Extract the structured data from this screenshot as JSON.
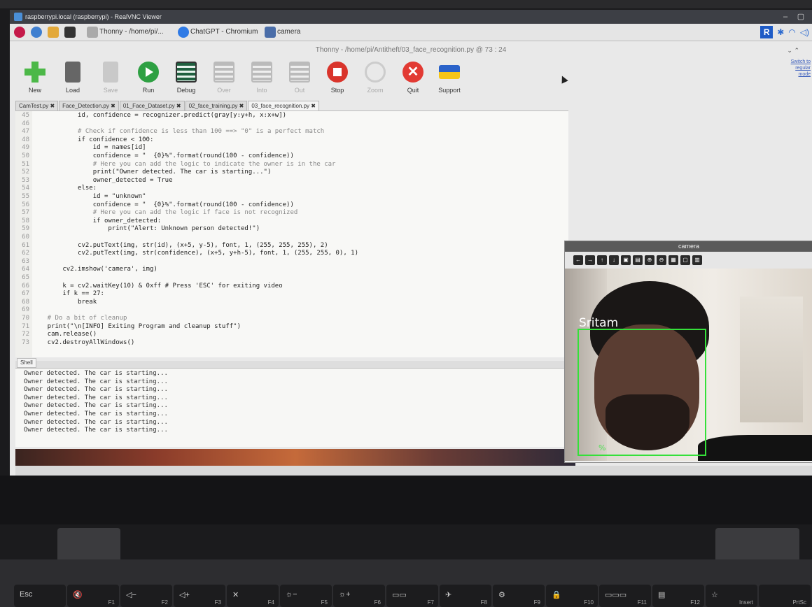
{
  "vnc": {
    "title": "raspberrypi.local (raspberrypi) - RealVNC Viewer"
  },
  "taskbar": {
    "items": [
      {
        "label": "Thonny  -  /home/pi/..."
      },
      {
        "label": "ChatGPT - Chromium"
      },
      {
        "label": "camera"
      }
    ]
  },
  "thonny": {
    "title": "Thonny  -  /home/pi/Antitheft/03_face_recognition.py  @  73 : 24",
    "switch_link": "Switch to regular mode",
    "toolbar": {
      "new": "New",
      "load": "Load",
      "save": "Save",
      "run": "Run",
      "debug": "Debug",
      "over": "Over",
      "into": "Into",
      "out": "Out",
      "stop": "Stop",
      "zoom": "Zoom",
      "quit": "Quit",
      "support": "Support"
    },
    "tabs": [
      {
        "label": "CamTest.py ✖"
      },
      {
        "label": "Face_Detection.py ✖"
      },
      {
        "label": "01_Face_Dataset.py ✖"
      },
      {
        "label": "02_face_training.py ✖"
      },
      {
        "label": "03_face_recognition.py ✖"
      }
    ],
    "code": [
      {
        "ln": "45",
        "text": "            id, confidence = recognizer.predict(gray[y:y+h, x:x+w])"
      },
      {
        "ln": "46",
        "text": ""
      },
      {
        "ln": "47",
        "text": "            # Check if confidence is less than 100 ==> \"0\" is a perfect match"
      },
      {
        "ln": "48",
        "text": "            if confidence < 100:"
      },
      {
        "ln": "49",
        "text": "                id = names[id]"
      },
      {
        "ln": "50",
        "text": "                confidence = \"  {0}%\".format(round(100 - confidence))"
      },
      {
        "ln": "51",
        "text": "                # Here you can add the logic to indicate the owner is in the car"
      },
      {
        "ln": "52",
        "text": "                print(\"Owner detected. The car is starting...\")"
      },
      {
        "ln": "53",
        "text": "                owner_detected = True"
      },
      {
        "ln": "54",
        "text": "            else:"
      },
      {
        "ln": "55",
        "text": "                id = \"unknown\""
      },
      {
        "ln": "56",
        "text": "                confidence = \"  {0}%\".format(round(100 - confidence))"
      },
      {
        "ln": "57",
        "text": "                # Here you can add the logic if face is not recognized"
      },
      {
        "ln": "58",
        "text": "                if owner_detected:"
      },
      {
        "ln": "59",
        "text": "                    print(\"Alert: Unknown person detected!\")"
      },
      {
        "ln": "60",
        "text": ""
      },
      {
        "ln": "61",
        "text": "            cv2.putText(img, str(id), (x+5, y-5), font, 1, (255, 255, 255), 2)"
      },
      {
        "ln": "62",
        "text": "            cv2.putText(img, str(confidence), (x+5, y+h-5), font, 1, (255, 255, 0), 1)"
      },
      {
        "ln": "63",
        "text": ""
      },
      {
        "ln": "64",
        "text": "        cv2.imshow('camera', img)"
      },
      {
        "ln": "65",
        "text": ""
      },
      {
        "ln": "66",
        "text": "        k = cv2.waitKey(10) & 0xff # Press 'ESC' for exiting video"
      },
      {
        "ln": "67",
        "text": "        if k == 27:"
      },
      {
        "ln": "68",
        "text": "            break"
      },
      {
        "ln": "69",
        "text": ""
      },
      {
        "ln": "70",
        "text": "    # Do a bit of cleanup"
      },
      {
        "ln": "71",
        "text": "    print(\"\\n[INFO] Exiting Program and cleanup stuff\")"
      },
      {
        "ln": "72",
        "text": "    cam.release()"
      },
      {
        "ln": "73",
        "text": "    cv2.destroyAllWindows()"
      }
    ],
    "shell_label": "Shell",
    "shell_lines": [
      "Owner detected. The car is starting...",
      "Owner detected. The car is starting...",
      "Owner detected. The car is starting...",
      "Owner detected. The car is starting...",
      "Owner detected. The car is starting...",
      "Owner detected. The car is starting...",
      "Owner detected. The car is starting...",
      "Owner detected. The car is starting..."
    ]
  },
  "camera": {
    "title": "camera",
    "face_label": "Sritam",
    "confidence_label": "  %"
  },
  "keyboard": {
    "keys": [
      {
        "main": "Esc",
        "fn": ""
      },
      {
        "main": "🔇",
        "fn": "F1"
      },
      {
        "main": "◁−",
        "fn": "F2"
      },
      {
        "main": "◁+",
        "fn": "F3"
      },
      {
        "main": "✕",
        "fn": "F4"
      },
      {
        "main": "☼−",
        "fn": "F5"
      },
      {
        "main": "☼+",
        "fn": "F6"
      },
      {
        "main": "▭▭",
        "fn": "F7"
      },
      {
        "main": "✈",
        "fn": "F8"
      },
      {
        "main": "⚙",
        "fn": "F9"
      },
      {
        "main": "🔒",
        "fn": "F10"
      },
      {
        "main": "▭▭▭",
        "fn": "F11"
      },
      {
        "main": "▤",
        "fn": "F12"
      },
      {
        "main": "☆",
        "fn": "Insert"
      },
      {
        "main": "",
        "fn": "PrtSc"
      }
    ]
  },
  "colors": {
    "run_green": "#2ea043",
    "stop_red": "#d9342b",
    "face_box_green": "#35e03a"
  }
}
